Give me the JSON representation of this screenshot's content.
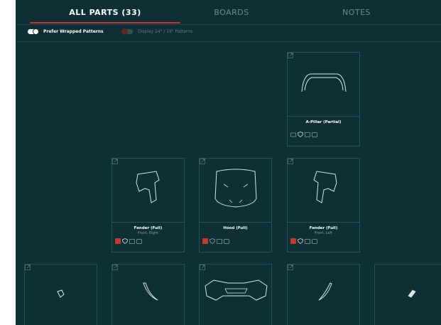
{
  "tabs": [
    {
      "label": "ALL PARTS (33)",
      "active": true
    },
    {
      "label": "BOARDS",
      "active": false
    },
    {
      "label": "NOTES",
      "active": false
    }
  ],
  "toggles": {
    "prefer_wrapped": {
      "label": "Prefer Wrapped Patterns",
      "on": true
    },
    "display_24": {
      "label": "Display 24\" / 18\" Patterns",
      "on": false
    }
  },
  "parts": [
    {
      "name": "A-Pillar (Partial)",
      "sub": "",
      "shape": "a-pillar"
    },
    {
      "name": "Fender (Full)",
      "sub": "Front, Right",
      "shape": "fender-right"
    },
    {
      "name": "Hood (Full)",
      "sub": "",
      "shape": "hood"
    },
    {
      "name": "Fender (Full)",
      "sub": "Front, Left",
      "shape": "fender-left"
    }
  ],
  "colors": {
    "background": "#0f2f36",
    "accent": "#c4392f",
    "card_border": "#2a5058"
  }
}
